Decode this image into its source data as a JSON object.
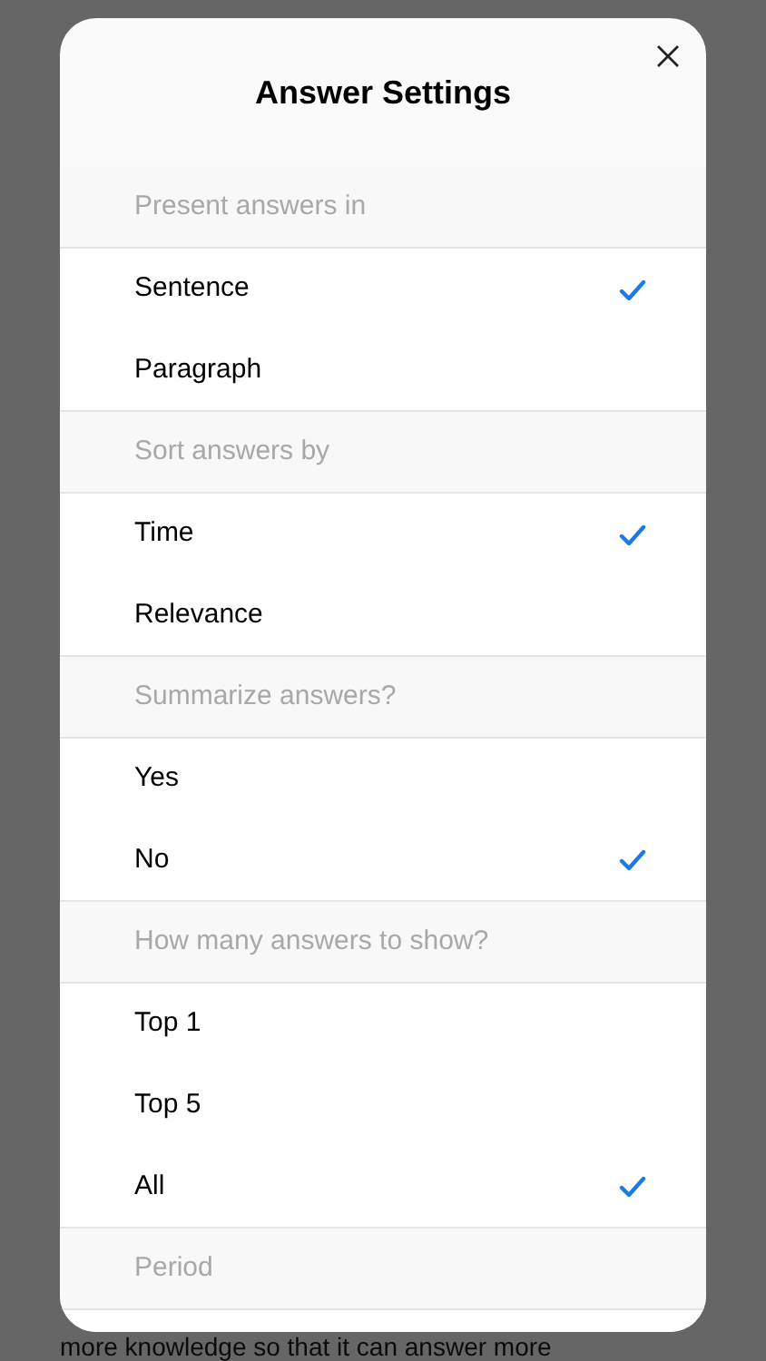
{
  "dialog": {
    "title": "Answer Settings"
  },
  "sections": [
    {
      "header": "Present answers in",
      "options": [
        {
          "label": "Sentence",
          "selected": true
        },
        {
          "label": "Paragraph",
          "selected": false
        }
      ]
    },
    {
      "header": "Sort answers by",
      "options": [
        {
          "label": "Time",
          "selected": true
        },
        {
          "label": "Relevance",
          "selected": false
        }
      ]
    },
    {
      "header": "Summarize answers?",
      "options": [
        {
          "label": "Yes",
          "selected": false
        },
        {
          "label": "No",
          "selected": true
        }
      ]
    },
    {
      "header": "How many answers to show?",
      "options": [
        {
          "label": "Top 1",
          "selected": false
        },
        {
          "label": "Top 5",
          "selected": false
        },
        {
          "label": "All",
          "selected": true
        }
      ]
    },
    {
      "header": "Period"
    }
  ],
  "background_text": "more knowledge so that it can answer more"
}
